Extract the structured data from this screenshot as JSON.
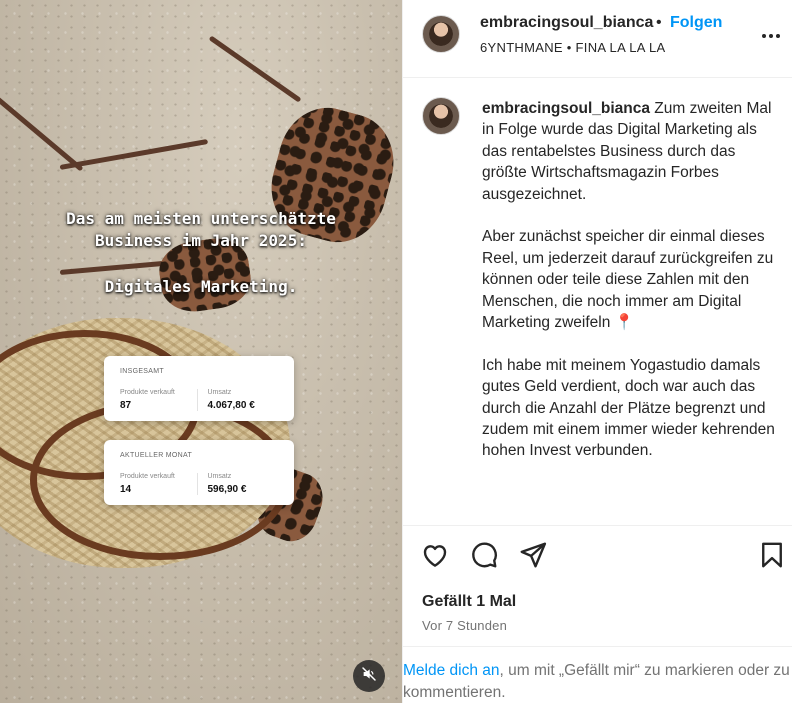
{
  "post": {
    "username": "embracingsoul_bianca",
    "separator": "•",
    "follow_label": "Folgen",
    "audio": "6YNTHMANE • FINA LA LA LA"
  },
  "media": {
    "overlay_line1": "Das am meisten unterschätzte",
    "overlay_line2": "Business im Jahr 2025:",
    "overlay_line3": "Digitales Marketing.",
    "cards": [
      {
        "header": "INSGESAMT",
        "left_label": "Produkte verkauft",
        "left_value": "87",
        "right_label": "Umsatz",
        "right_value": "4.067,80 €"
      },
      {
        "header": "AKTUELLER MONAT",
        "left_label": "Produkte verkauft",
        "left_value": "14",
        "right_label": "Umsatz",
        "right_value": "596,90 €"
      }
    ]
  },
  "caption": {
    "username": "embracingsoul_bianca",
    "p1": "Zum zweiten Mal in Folge wurde das Digital Marketing als das rentabelstes Business durch das größte Wirtschaftsmagazin Forbes ausgezeichnet.",
    "p2": "Aber zunächst speicher dir einmal dieses Reel, um jederzeit darauf zurückgreifen zu können oder teile diese Zahlen mit den Menschen, die noch immer am Digital Marketing zweifeln 📍",
    "p3": "Ich habe mit meinem Yogastudio damals gutes Geld verdient, doch war auch das durch die Anzahl der Plätze begrenzt und zudem mit einem immer wieder kehrenden hohen Invest verbunden."
  },
  "engagement": {
    "likes": "Gefällt 1 Mal",
    "time": "Vor 7 Stunden",
    "login_link": "Melde dich an",
    "login_rest": ", um mit „Gefällt mir“ zu markieren oder zu kommentieren."
  },
  "icons": {
    "like": "heart-icon",
    "comment": "comment-icon",
    "share": "paper-plane-icon",
    "save": "bookmark-icon",
    "more": "more-dots-icon",
    "mute": "speaker-muted-icon"
  }
}
